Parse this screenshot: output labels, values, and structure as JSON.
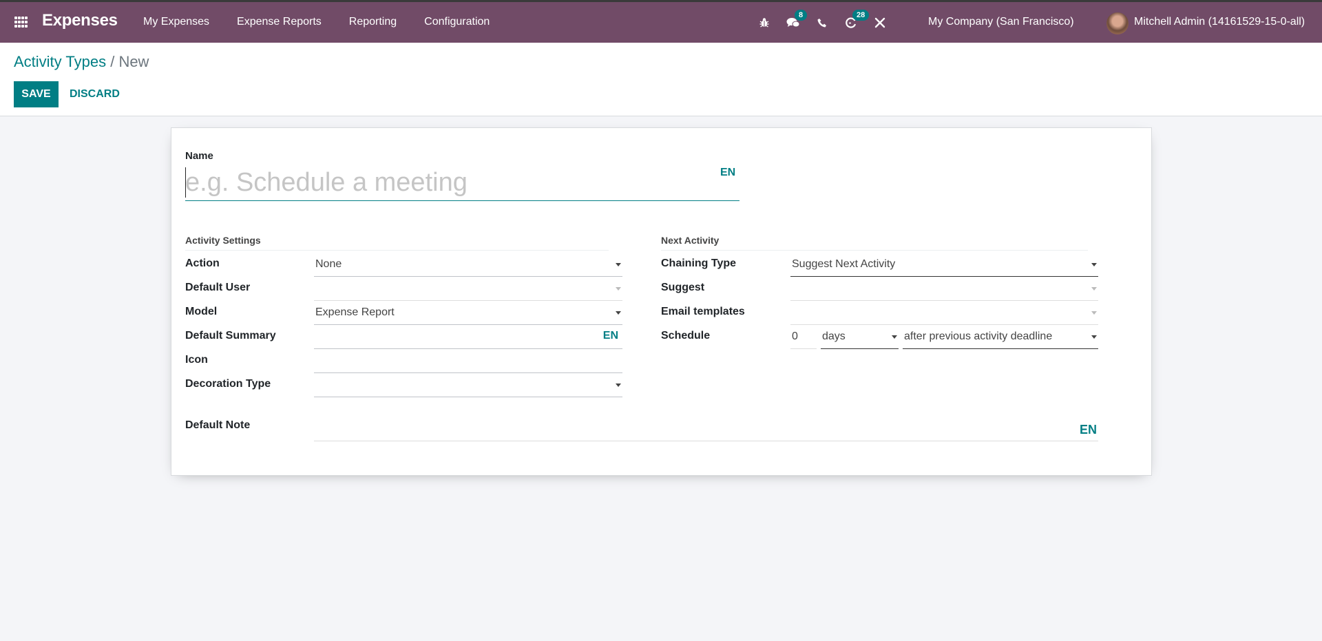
{
  "navbar": {
    "app_name": "Expenses",
    "menu": [
      "My Expenses",
      "Expense Reports",
      "Reporting",
      "Configuration"
    ],
    "messages_count": "8",
    "activities_count": "28",
    "company": "My Company (San Francisco)",
    "user": "Mitchell Admin (14161529-15-0-all)",
    "colors": {
      "bar": "#714b67",
      "badge": "#017e84"
    }
  },
  "breadcrumb": {
    "parent": "Activity Types",
    "separator": " / ",
    "current": "New"
  },
  "buttons": {
    "save": "SAVE",
    "discard": "DISCARD"
  },
  "form": {
    "name_label": "Name",
    "name_placeholder": "e.g. Schedule a meeting",
    "name_value": "",
    "lang": "EN",
    "activity_settings": {
      "title": "Activity Settings",
      "action": {
        "label": "Action",
        "value": "None"
      },
      "default_user": {
        "label": "Default User",
        "value": ""
      },
      "model": {
        "label": "Model",
        "value": "Expense Report"
      },
      "default_summary": {
        "label": "Default Summary",
        "value": ""
      },
      "icon": {
        "label": "Icon",
        "value": ""
      },
      "decoration_type": {
        "label": "Decoration Type",
        "value": ""
      }
    },
    "next_activity": {
      "title": "Next Activity",
      "chaining_type": {
        "label": "Chaining Type",
        "value": "Suggest Next Activity"
      },
      "suggest": {
        "label": "Suggest",
        "value": ""
      },
      "email_templates": {
        "label": "Email templates",
        "value": ""
      },
      "schedule": {
        "label": "Schedule",
        "delay": "0",
        "unit": "days",
        "from": "after previous activity deadline"
      }
    },
    "default_note": {
      "label": "Default Note",
      "value": ""
    }
  }
}
